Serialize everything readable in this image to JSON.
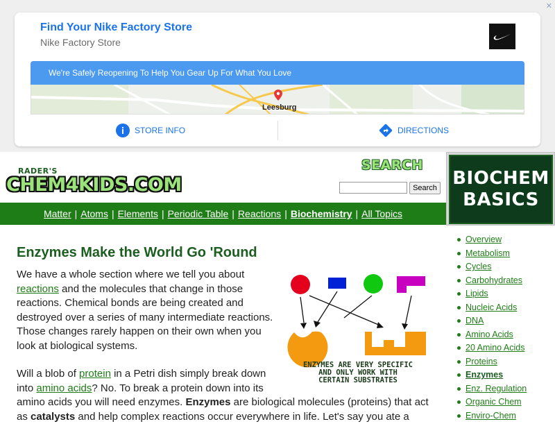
{
  "ad": {
    "close_label": "✕",
    "title": "Find Your Nike Factory Store",
    "subtitle": "Nike Factory Store",
    "banner": "We're Safely Reopening To Help You Gear Up For What You Love",
    "map_label": "Leesburg",
    "store_info": "STORE INFO",
    "directions": "DIRECTIONS",
    "accent": "#1a73e8"
  },
  "header": {
    "logo_small": "RADER'S",
    "logo_main": "CHEM4KIDS.COM",
    "search_title": "SEARCH",
    "search_value": "",
    "search_button": "Search",
    "promo_line1": "BIOCHEM",
    "promo_line2": "BASICS"
  },
  "nav": {
    "items": [
      {
        "label": "Matter"
      },
      {
        "label": "Atoms"
      },
      {
        "label": "Elements"
      },
      {
        "label": "Periodic Table"
      },
      {
        "label": "Reactions"
      },
      {
        "label": "Biochemistry"
      },
      {
        "label": "All Topics"
      }
    ],
    "separator": "|",
    "color": "#1e7d16"
  },
  "main": {
    "title": "Enzymes Make the World Go 'Round",
    "p1": {
      "a": "We have a whole section where we tell you about ",
      "link1": "reactions",
      "b": " and the molecules that change in those reactions. Chemical bonds are being created and destroyed over a series of many intermediate reactions. Those changes rarely happen on their own when you look at biological systems."
    },
    "p2": {
      "a": "Will a blob of ",
      "link1": "protein",
      "b": " in a Petri dish simply break down into ",
      "link2": "amino acids",
      "c": "? No. To break a protein down into its",
      "d": "amino acids you will need enzymes. ",
      "bold1": "Enzymes",
      "e": " are biological molecules (proteins) that act",
      "f": "as ",
      "bold2": "catalysts",
      "g": " and help complex reactions occur everywhere in life. Let's say you ate a"
    },
    "diagram_caption_1": "ENZYMES ARE VERY SPECIFIC",
    "diagram_caption_2": "AND ONLY WORK WITH",
    "diagram_caption_3": "CERTAIN SUBSTRATES"
  },
  "sidebar": {
    "items": [
      {
        "label": "Overview"
      },
      {
        "label": "Metabolism"
      },
      {
        "label": "Cycles"
      },
      {
        "label": "Carbohydrates"
      },
      {
        "label": "Lipids"
      },
      {
        "label": "Nucleic Acids"
      },
      {
        "label": "DNA"
      },
      {
        "label": "Amino Acids"
      },
      {
        "label": "20 Amino Acids"
      },
      {
        "label": "Proteins"
      },
      {
        "label": "Enzymes"
      },
      {
        "label": "Enz. Regulation"
      },
      {
        "label": "Organic Chem"
      },
      {
        "label": "Enviro-Chem"
      }
    ]
  }
}
